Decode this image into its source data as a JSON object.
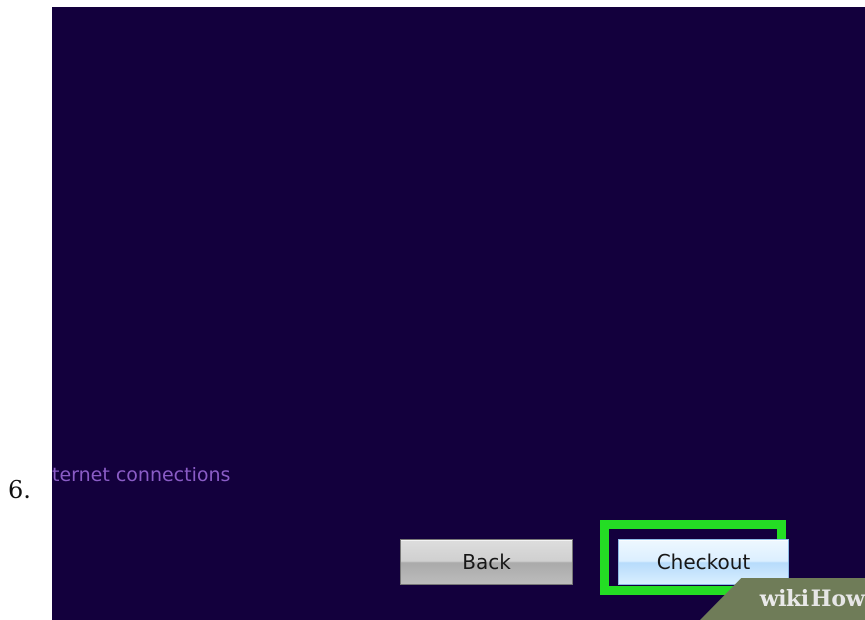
{
  "step": {
    "number": "6."
  },
  "screen": {
    "connection_text": "ternet connections"
  },
  "buttons": {
    "back_label": "Back",
    "checkout_label": "Checkout"
  },
  "watermark": {
    "brand_wiki": "wiki",
    "brand_how": "How"
  },
  "colors": {
    "background": "#13003d",
    "highlight": "#24dd24",
    "connection_text": "#8a5cc6"
  }
}
